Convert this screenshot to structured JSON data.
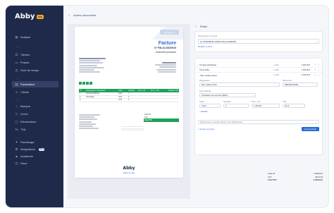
{
  "sidebar": {
    "logo": "Abby",
    "logo_badge": "PRO",
    "items": [
      {
        "label": "Analyse",
        "icon": "chart-icon"
      },
      {
        "label": "Tâches",
        "icon": "tasks-icon"
      },
      {
        "label": "Projets",
        "icon": "folder-icon"
      },
      {
        "label": "Suivi du temps",
        "icon": "clock-icon"
      },
      {
        "label": "Facturation",
        "icon": "invoice-icon",
        "active": true
      },
      {
        "label": "Clients",
        "icon": "users-icon"
      },
      {
        "label": "Banque",
        "icon": "bank-icon"
      },
      {
        "label": "Livres",
        "icon": "book-icon"
      },
      {
        "label": "Déclarations",
        "icon": "file-icon"
      },
      {
        "label": "TVA",
        "icon": "percent-icon"
      },
      {
        "label": "Parrainage",
        "icon": "gift-icon"
      },
      {
        "label": "Intégrations",
        "icon": "plug-icon",
        "badge": "Beta"
      },
      {
        "label": "Académie",
        "icon": "graduation-icon"
      },
      {
        "label": "Store",
        "icon": "store-icon"
      }
    ]
  },
  "back_link": "Autres documents",
  "preview": {
    "ribbon": "Enregistrer",
    "title": "Facture",
    "number": "N° F06-10-2022/0015",
    "subtitle": "Document provisoire",
    "table_headers": [
      "N°",
      "Désignation et description",
      "Unité",
      "Quantité",
      "Prix u. HT",
      "Prix u. TTC",
      "Montant TTC"
    ],
    "rows": [
      [
        "1",
        "Conseil graphique",
        "unité",
        "1",
        "",
        "",
        ""
      ],
      [
        "2",
        "Tonic Abby",
        "unité",
        "1",
        "",
        "",
        ""
      ],
      [
        "3",
        "",
        "unité",
        "1",
        "",
        "",
        ""
      ]
    ],
    "totals": [
      {
        "label": "Total HT",
        "value": ""
      },
      {
        "label": "TVA",
        "value": ""
      },
      {
        "label": "Total TTC",
        "value": ""
      }
    ],
    "footer_logo": "Abby",
    "footer_note": "Retirer le logo"
  },
  "form": {
    "header": "Éditer",
    "client_label": "Sélectionnez un client",
    "client_value": "MONSIEUR CHRISTIAN ALLEMAND",
    "client_link": "Modifier le client",
    "line_items": [
      {
        "name": "Conseil graphique",
        "meta": "1 unité",
        "amount": "1 000,00 €"
      },
      {
        "name": "Tonic Abby",
        "meta": "1 unité",
        "amount": "1 000,00 €"
      },
      {
        "name": "Bon cadeau Noël",
        "meta": "1 unité",
        "amount": "1 000,00 €"
      }
    ],
    "designation_label": "Désignation",
    "designation_value": "Bon cadeau Noël",
    "reference_label": "Référence",
    "reference_value": "REF-BON-0001",
    "type_label": "Type d'article",
    "type_value": "Prestations de services (BNC)",
    "unit_label": "Unité",
    "unit_value": "Unité",
    "qty_label": "Quantité",
    "qty_value": "1",
    "price_label": "Prix u. HT",
    "price_value": "1 000,00",
    "vat_label": "TVA",
    "vat_value": "20 %",
    "details_link": "Détailler",
    "add_select_placeholder": "Sélectionnez un article depuis votre bibliothèque",
    "add_link": "Ajouter une ligne",
    "add_button": "Nouvel article",
    "summary": [
      {
        "label": "Total HT",
        "value": "1 666,66 €"
      },
      {
        "label": "TVA",
        "value": "333,34 €"
      },
      {
        "label": "Total TTC",
        "value": "2 000,00 €"
      }
    ]
  }
}
